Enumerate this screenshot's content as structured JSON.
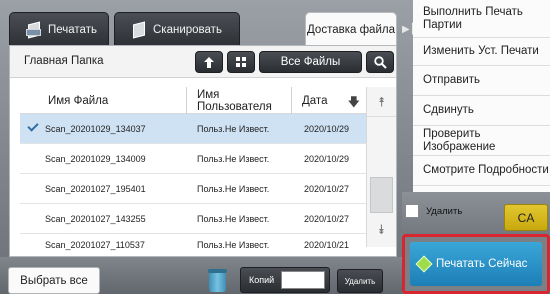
{
  "tabs": {
    "print": "Печатать",
    "scan": "Сканировать",
    "delivery": "Доставка файла"
  },
  "header": {
    "folder_title": "Главная Папка",
    "all_files": "Все Файлы"
  },
  "columns": {
    "name": "Имя Файла",
    "user": "Имя Пользователя",
    "date": "Дата"
  },
  "files": [
    {
      "name": "Scan_20201029_134037",
      "user": "Польз.Не Извест.",
      "date": "2020/10/29",
      "selected": true
    },
    {
      "name": "Scan_20201029_134009",
      "user": "Польз.Не Извест.",
      "date": "2020/10/29",
      "selected": false
    },
    {
      "name": "Scan_20201027_195401",
      "user": "Польз.Не Извест.",
      "date": "2020/10/27",
      "selected": false
    },
    {
      "name": "Scan_20201027_143255",
      "user": "Польз.Не Извест.",
      "date": "2020/10/27",
      "selected": false
    },
    {
      "name": "Scan_20201027_110537",
      "user": "Польз.Не Извест.",
      "date": "2020/10/21",
      "selected": false
    }
  ],
  "bottom": {
    "select_all": "Выбрать все",
    "copies_label": "Копий",
    "copies_value": "",
    "delete_small": "Удалить"
  },
  "right_menu": {
    "items": [
      "Выполнить Печать Партии",
      "Изменить Уст. Печати",
      "Отправить",
      "Сдвинуть",
      "Проверить Изображение",
      "Смотрите Подробности"
    ],
    "delete_label": "Удалить",
    "ca": "CA",
    "print_now": "Печатать Сейчас"
  },
  "icons": {
    "up": "arrow-up-icon",
    "grid": "grid-icon",
    "search": "search-icon",
    "sort": "sort-down-icon",
    "scroll_up": "double-up-icon",
    "scroll_down": "double-down-icon",
    "trash": "trash-icon",
    "start": "start-icon"
  },
  "colors": {
    "selected_row": "#cfe2f4",
    "ca_button": "#d8bb1f",
    "print_now": "#2a93c9",
    "highlight_frame": "#d7262f"
  }
}
